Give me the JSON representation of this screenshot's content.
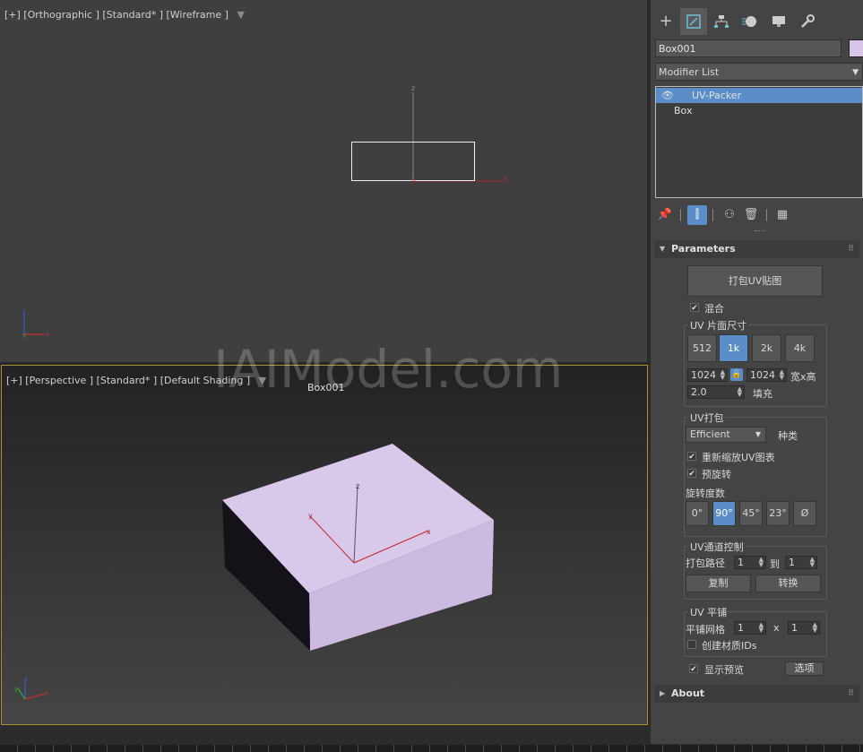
{
  "top_viewport": {
    "label": "[+] [Orthographic ] [Standard* ] [Wireframe ]",
    "axis_x": "x",
    "axis_y": "y",
    "axis_z": "z"
  },
  "persp_viewport": {
    "label": "[+] [Perspective ] [Standard* ] [Default Shading ]",
    "object_label": "Box001",
    "axis_x": "x",
    "axis_y": "y",
    "axis_z": "z"
  },
  "watermark": "IAIModel.com",
  "panel": {
    "object_name": "Box001",
    "object_color": "#d9c5e8",
    "modifier_list": "Modifier List",
    "stack": [
      {
        "label": "UV-Packer",
        "selected": true
      },
      {
        "label": "Box",
        "selected": false
      }
    ]
  },
  "parameters": {
    "title": "Parameters",
    "pack_button": "打包UV贴图",
    "mix_label": "混合",
    "mix_checked": true,
    "uv_size": {
      "title": "UV 片面尺寸",
      "options": [
        "512",
        "1k",
        "2k",
        "4k"
      ],
      "selected": "1k",
      "width": "1024",
      "height": "1024",
      "wh_label": "宽x高",
      "padding": "2.0",
      "padding_label": "填充"
    },
    "uv_pack": {
      "title": "UV打包",
      "method": "Efficient",
      "method_label": "种类",
      "rescale_label": "重新缩放UV图表",
      "rescale_checked": true,
      "prerotate_label": "预旋转",
      "prerotate_checked": true,
      "rotation_label": "旋转度数",
      "rotations": [
        "0°",
        "90°",
        "45°",
        "23°",
        "Ø"
      ],
      "rotation_selected": "90°"
    },
    "uv_channel": {
      "title": "UV通道控制",
      "path_label": "打包路径",
      "from": "1",
      "to_label": "到",
      "to": "1",
      "copy_label": "复制",
      "convert_label": "转换"
    },
    "uv_tile": {
      "title": "UV 平铺",
      "grid_label": "平铺网格",
      "grid_x": "1",
      "x_label": "x",
      "grid_y": "1",
      "mat_ids_label": "创建材质IDs",
      "mat_ids_checked": false
    },
    "preview_label": "显示预览",
    "preview_checked": true,
    "options_button": "选项"
  },
  "about": {
    "title": "About"
  }
}
